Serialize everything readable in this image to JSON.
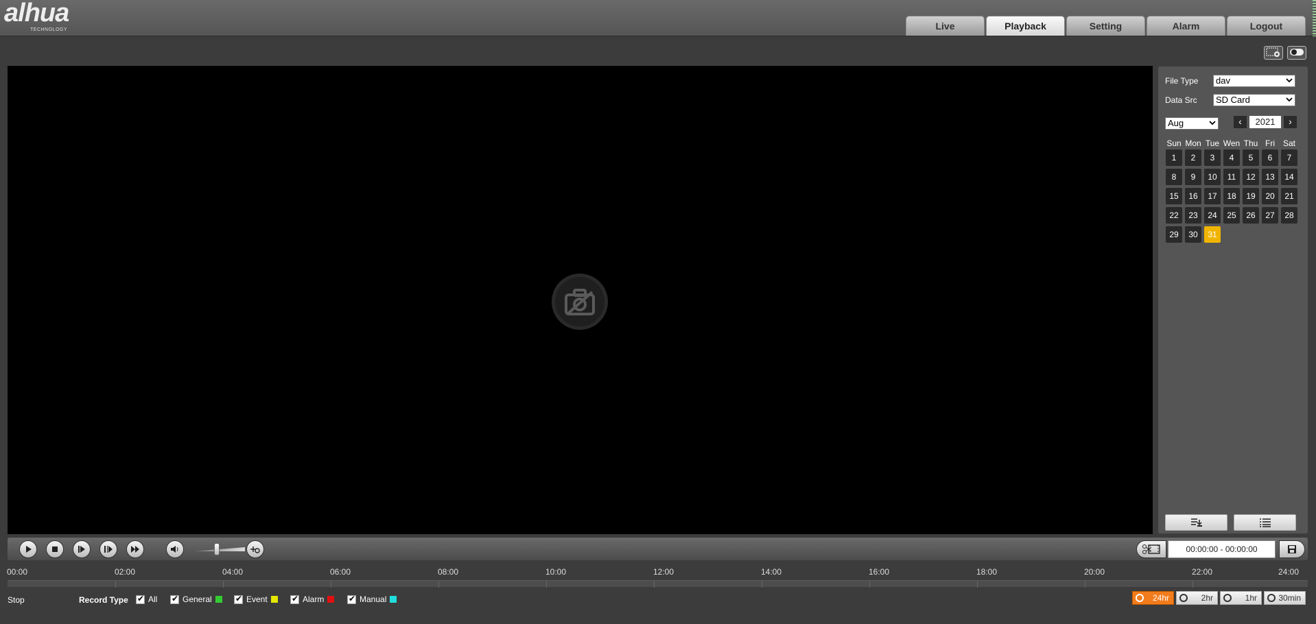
{
  "header": {
    "brand": "alhua",
    "brand_sub": "TECHNOLOGY",
    "tabs": [
      {
        "label": "Live"
      },
      {
        "label": "Playback"
      },
      {
        "label": "Setting"
      },
      {
        "label": "Alarm"
      },
      {
        "label": "Logout"
      }
    ],
    "active_tab": "Playback"
  },
  "panel": {
    "file_type_label": "File Type",
    "file_type_value": "dav",
    "data_src_label": "Data Src",
    "data_src_value": "SD Card",
    "month_value": "Aug",
    "year_value": "2021",
    "prev_symbol": "‹",
    "next_symbol": "›",
    "weekdays": [
      "Sun",
      "Mon",
      "Tue",
      "Wen",
      "Thu",
      "Fri",
      "Sat"
    ],
    "days": [
      "1",
      "2",
      "3",
      "4",
      "5",
      "6",
      "7",
      "8",
      "9",
      "10",
      "11",
      "12",
      "13",
      "14",
      "15",
      "16",
      "17",
      "18",
      "19",
      "20",
      "21",
      "22",
      "23",
      "24",
      "25",
      "26",
      "27",
      "28",
      "29",
      "30",
      "31"
    ],
    "selected_day": "31",
    "selected_color": "#f0b400"
  },
  "controls": {
    "time_range": "00:00:00 - 00:00:00"
  },
  "timeline": {
    "labels": [
      "00:00",
      "02:00",
      "04:00",
      "06:00",
      "08:00",
      "10:00",
      "12:00",
      "14:00",
      "16:00",
      "18:00",
      "20:00",
      "22:00",
      "24:00"
    ]
  },
  "bottom": {
    "status": "Stop",
    "record_type_label": "Record Type",
    "record_types": [
      {
        "label": "All",
        "color": ""
      },
      {
        "label": "General",
        "color": "#33cc33"
      },
      {
        "label": "Event",
        "color": "#e6e600"
      },
      {
        "label": "Alarm",
        "color": "#e01010"
      },
      {
        "label": "Manual",
        "color": "#22dddd"
      }
    ],
    "zoom_options": [
      "24hr",
      "2hr",
      "1hr",
      "30min"
    ],
    "zoom_active": "24hr",
    "zoom_active_color": "#f27c1c"
  }
}
